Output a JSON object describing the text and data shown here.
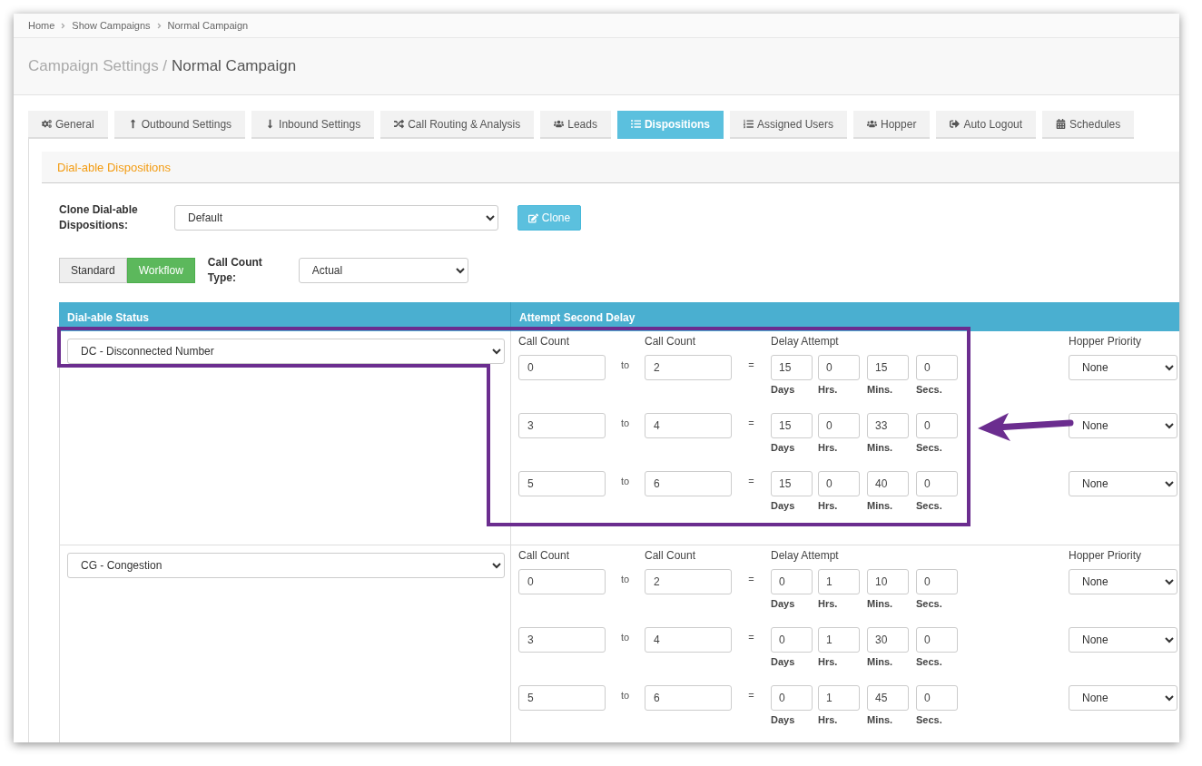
{
  "breadcrumbs": [
    "Home",
    "Show Campaigns",
    "Normal Campaign"
  ],
  "page_title": {
    "section": "Campaign Settings /",
    "name": "Normal Campaign"
  },
  "tabs": [
    {
      "label": "General",
      "selected": false
    },
    {
      "label": "Outbound Settings",
      "selected": false
    },
    {
      "label": "Inbound Settings",
      "selected": false
    },
    {
      "label": "Call Routing & Analysis",
      "selected": false
    },
    {
      "label": "Leads",
      "selected": false
    },
    {
      "label": "Dispositions",
      "selected": true
    },
    {
      "label": "Assigned Users",
      "selected": false
    },
    {
      "label": "Hopper",
      "selected": false
    },
    {
      "label": "Auto Logout",
      "selected": false
    },
    {
      "label": "Schedules",
      "selected": false
    }
  ],
  "panel_title": "Dial-able Dispositions",
  "clone": {
    "label": "Clone Dial-able Dispositions:",
    "value": "Default",
    "button": "Clone"
  },
  "mode_toggle": [
    {
      "label": "Standard",
      "selected": false
    },
    {
      "label": "Workflow",
      "selected": true
    }
  ],
  "call_count_type": {
    "label": "Call Count Type:",
    "value": "Actual"
  },
  "table": {
    "columns": [
      "Dial-able Status",
      "Attempt Second Delay"
    ],
    "rows": [
      {
        "status": "DC - Disconnected Number",
        "headers": {
          "from": "Call Count",
          "to": "Call Count",
          "delay": "Delay Attempt",
          "hopper": "Hopper Priority"
        },
        "attempts": [
          {
            "from": "0",
            "to_word": "to",
            "to": "2",
            "equals": "=",
            "delay": [
              {
                "value": "15",
                "unit": "Days"
              },
              {
                "value": "0",
                "unit": "Hrs."
              },
              {
                "value": "15",
                "unit": "Mins."
              },
              {
                "value": "0",
                "unit": "Secs."
              }
            ],
            "hopper": "None"
          },
          {
            "from": "3",
            "to_word": "to",
            "to": "4",
            "equals": "=",
            "delay": [
              {
                "value": "15",
                "unit": "Days"
              },
              {
                "value": "0",
                "unit": "Hrs."
              },
              {
                "value": "33",
                "unit": "Mins."
              },
              {
                "value": "0",
                "unit": "Secs."
              }
            ],
            "hopper": "None"
          },
          {
            "from": "5",
            "to_word": "to",
            "to": "6",
            "equals": "=",
            "delay": [
              {
                "value": "15",
                "unit": "Days"
              },
              {
                "value": "0",
                "unit": "Hrs."
              },
              {
                "value": "40",
                "unit": "Mins."
              },
              {
                "value": "0",
                "unit": "Secs."
              }
            ],
            "hopper": "None"
          }
        ]
      },
      {
        "status": "CG - Congestion",
        "headers": {
          "from": "Call Count",
          "to": "Call Count",
          "delay": "Delay Attempt",
          "hopper": "Hopper Priority"
        },
        "attempts": [
          {
            "from": "0",
            "to_word": "to",
            "to": "2",
            "equals": "=",
            "delay": [
              {
                "value": "0",
                "unit": "Days"
              },
              {
                "value": "1",
                "unit": "Hrs."
              },
              {
                "value": "10",
                "unit": "Mins."
              },
              {
                "value": "0",
                "unit": "Secs."
              }
            ],
            "hopper": "None"
          },
          {
            "from": "3",
            "to_word": "to",
            "to": "4",
            "equals": "=",
            "delay": [
              {
                "value": "0",
                "unit": "Days"
              },
              {
                "value": "1",
                "unit": "Hrs."
              },
              {
                "value": "30",
                "unit": "Mins."
              },
              {
                "value": "0",
                "unit": "Secs."
              }
            ],
            "hopper": "None"
          },
          {
            "from": "5",
            "to_word": "to",
            "to": "6",
            "equals": "=",
            "delay": [
              {
                "value": "0",
                "unit": "Days"
              },
              {
                "value": "1",
                "unit": "Hrs."
              },
              {
                "value": "45",
                "unit": "Mins."
              },
              {
                "value": "0",
                "unit": "Secs."
              }
            ],
            "hopper": "None"
          }
        ]
      }
    ]
  }
}
